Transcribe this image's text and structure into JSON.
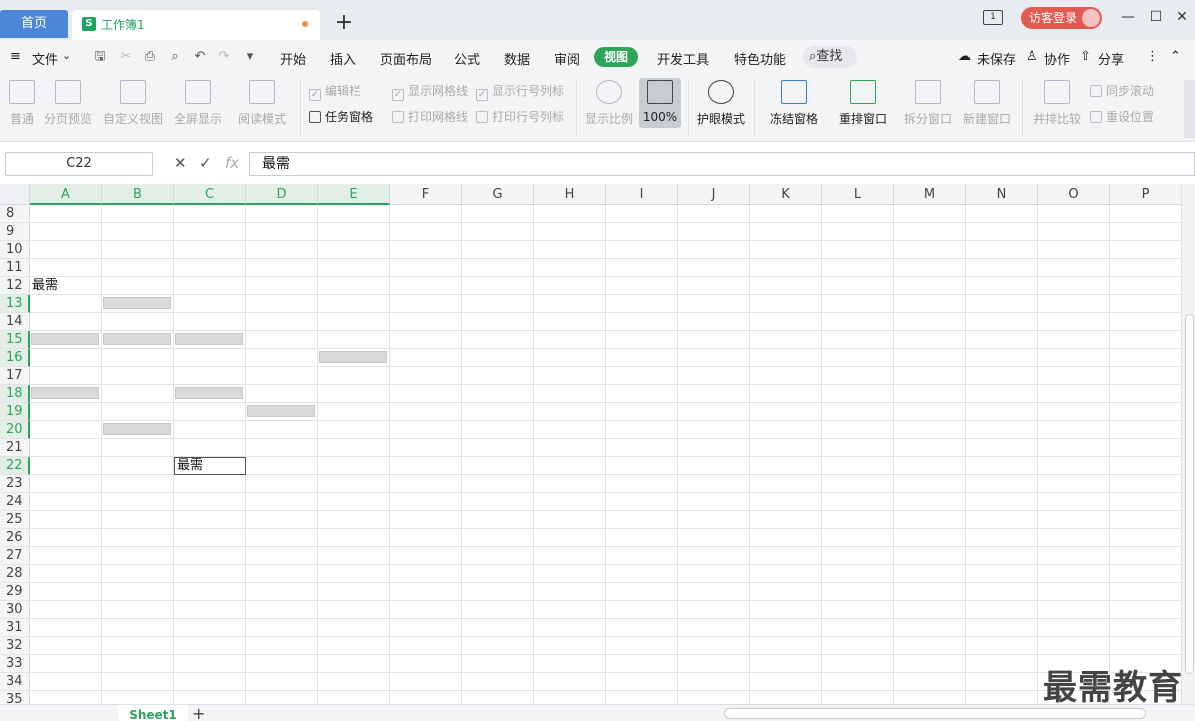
{
  "titlebar": {
    "home_tab": "首页",
    "doc_icon_letter": "S",
    "doc_title": "工作簿1",
    "new_tab": "+",
    "window_icon_num": "1",
    "login": "访客登录",
    "minimize": "—",
    "maximize": "☐",
    "close": "✕"
  },
  "menubar": {
    "file": "文件",
    "items": [
      "开始",
      "插入",
      "页面布局",
      "公式",
      "数据",
      "审阅",
      "视图",
      "开发工具",
      "特色功能"
    ],
    "active": "视图",
    "find": "查找",
    "unsaved": "未保存",
    "collab": "协作",
    "share": "分享"
  },
  "ribbon": {
    "normal": "普通",
    "page_preview": "分页预览",
    "custom_view": "自定义视图",
    "full_screen": "全屏显示",
    "reading_mode": "阅读模式",
    "edit_bar": "编辑栏",
    "task_pane": "任务窗格",
    "show_grid": "显示网格线",
    "print_grid": "打印网格线",
    "show_headers": "显示行号列标",
    "print_headers": "打印行号列标",
    "zoom_ratio": "显示比例",
    "zoom_100": "100%",
    "eye_mode": "护眼模式",
    "freeze": "冻结窗格",
    "arrange": "重排窗口",
    "split": "拆分窗口",
    "new_window": "新建窗口",
    "side_by_side": "并排比较",
    "sync_scroll": "同步滚动",
    "reset_pos": "重设位置"
  },
  "formula": {
    "name_box": "C22",
    "cancel": "✕",
    "confirm": "✓",
    "fx": "fx",
    "content": "最需"
  },
  "grid": {
    "columns": [
      "A",
      "B",
      "C",
      "D",
      "E",
      "F",
      "G",
      "H",
      "I",
      "J",
      "K",
      "L",
      "M",
      "N",
      "O",
      "P"
    ],
    "selected_columns": [
      "A",
      "B",
      "C",
      "D",
      "E"
    ],
    "rows": [
      "8",
      "9",
      "10",
      "11",
      "12",
      "13",
      "14",
      "15",
      "16",
      "17",
      "18",
      "19",
      "20",
      "21",
      "22",
      "23",
      "24",
      "25",
      "26",
      "27",
      "28",
      "29",
      "30",
      "31",
      "32",
      "33",
      "34",
      "35"
    ],
    "selected_rows": [
      "13",
      "15",
      "16",
      "18",
      "19",
      "20",
      "22"
    ],
    "a12_text": "最需",
    "c22_text": "最需"
  },
  "sheetbar": {
    "sheet_name": "Sheet1",
    "add": "+"
  },
  "watermark": "最需教育"
}
